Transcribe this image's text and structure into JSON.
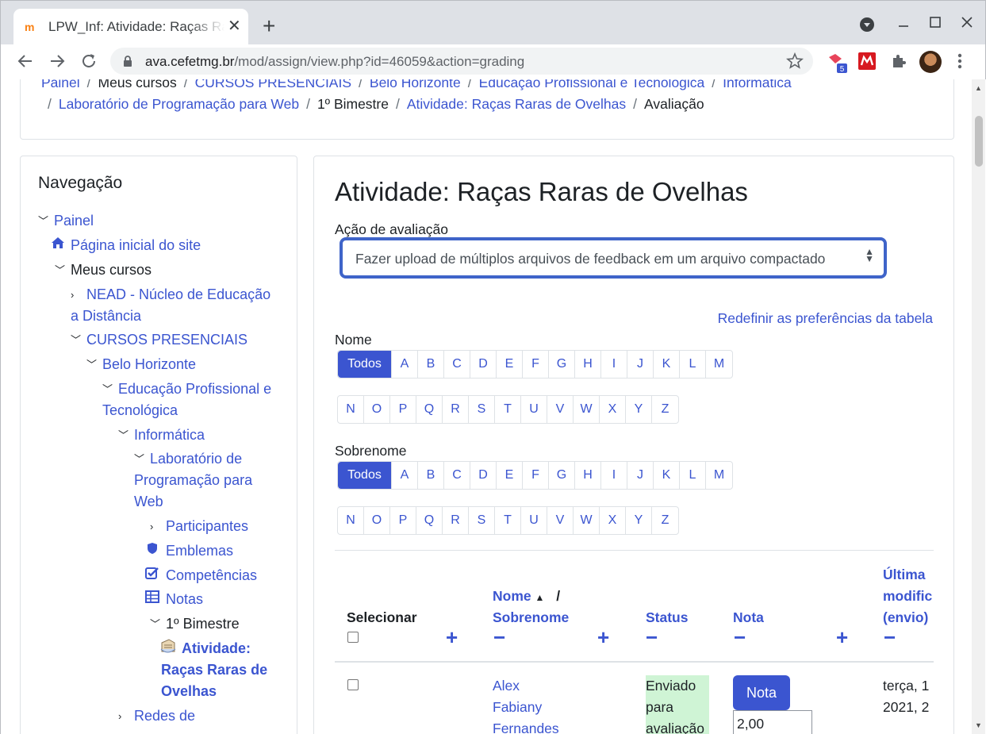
{
  "browser": {
    "tab_title": "LPW_Inf: Atividade: Raças Raras de Ovelhas",
    "favicon": "m",
    "close_glyph": "✕",
    "new_tab_glyph": "+",
    "url_host": "ava.cefetmg.br",
    "url_path": "/mod/assign/view.php?id=46059&action=grading",
    "extension_badge": "5"
  },
  "breadcrumb": [
    {
      "label": "Painel",
      "link": true
    },
    {
      "label": "Meus cursos",
      "link": false
    },
    {
      "label": "CURSOS PRESENCIAIS",
      "link": true
    },
    {
      "label": "Belo Horizonte",
      "link": true
    },
    {
      "label": "Educação Profissional e Tecnológica",
      "link": true
    },
    {
      "label": "Informática",
      "link": true
    },
    {
      "label": "Laboratório de Programação para Web",
      "link": true
    },
    {
      "label": "1º Bimestre",
      "link": false
    },
    {
      "label": "Atividade: Raças Raras de Ovelhas",
      "link": true
    },
    {
      "label": "Avaliação",
      "link": false
    }
  ],
  "nav": {
    "title": "Navegação",
    "painel": "Painel",
    "home": "Página inicial do site",
    "my_courses": "Meus cursos",
    "nead_1": "NEAD - Núcleo de Educação",
    "nead_2": "a Distância",
    "cursos_presenciais": "CURSOS PRESENCIAIS",
    "belo_horizonte": "Belo Horizonte",
    "ept_1": "Educação Profissional e",
    "ept_2": "Tecnológica",
    "informatica": "Informática",
    "lab_1": "Laboratório de",
    "lab_2": "Programação para",
    "lab_3": "Web",
    "participantes": "Participantes",
    "emblemas": "Emblemas",
    "competencias": "Competências",
    "notas": "Notas",
    "bimestre": "1º Bimestre",
    "atividade_1": "Atividade:",
    "atividade_2": "Raças Raras de",
    "atividade_3": "Ovelhas",
    "redes": "Redes de"
  },
  "main": {
    "title": "Atividade: Raças Raras de Ovelhas",
    "action_label": "Ação de avaliação",
    "action_selected": "Fazer upload de múltiplos arquivos de feedback em um arquivo compactado",
    "reset_prefs": "Redefinir as preferências da tabela",
    "first_name_label": "Nome",
    "last_name_label": "Sobrenome",
    "all_label": "Todos",
    "letters_row1": [
      "A",
      "B",
      "C",
      "D",
      "E",
      "F",
      "G",
      "H",
      "I",
      "J",
      "K",
      "L",
      "M"
    ],
    "letters_row2": [
      "N",
      "O",
      "P",
      "Q",
      "R",
      "S",
      "T",
      "U",
      "V",
      "W",
      "X",
      "Y",
      "Z"
    ]
  },
  "table": {
    "col_select": "Selecionar",
    "col_name": "Nome",
    "col_name_sep": "/",
    "col_surname": "Sobrenome",
    "col_status": "Status",
    "col_grade": "Nota",
    "col_modified_1": "Última",
    "col_modified_2": "modific",
    "col_modified_3": "(envio)",
    "rows": [
      {
        "name_1": "Alex",
        "name_2": "Fabiany",
        "name_3": "Fernandes",
        "status_1": "Enviado",
        "status_2": "para",
        "status_3": "avaliação",
        "grade_button": "Nota",
        "grade_value": "2,00",
        "modified_1": "terça, 1",
        "modified_2": "2021, 2"
      }
    ]
  }
}
